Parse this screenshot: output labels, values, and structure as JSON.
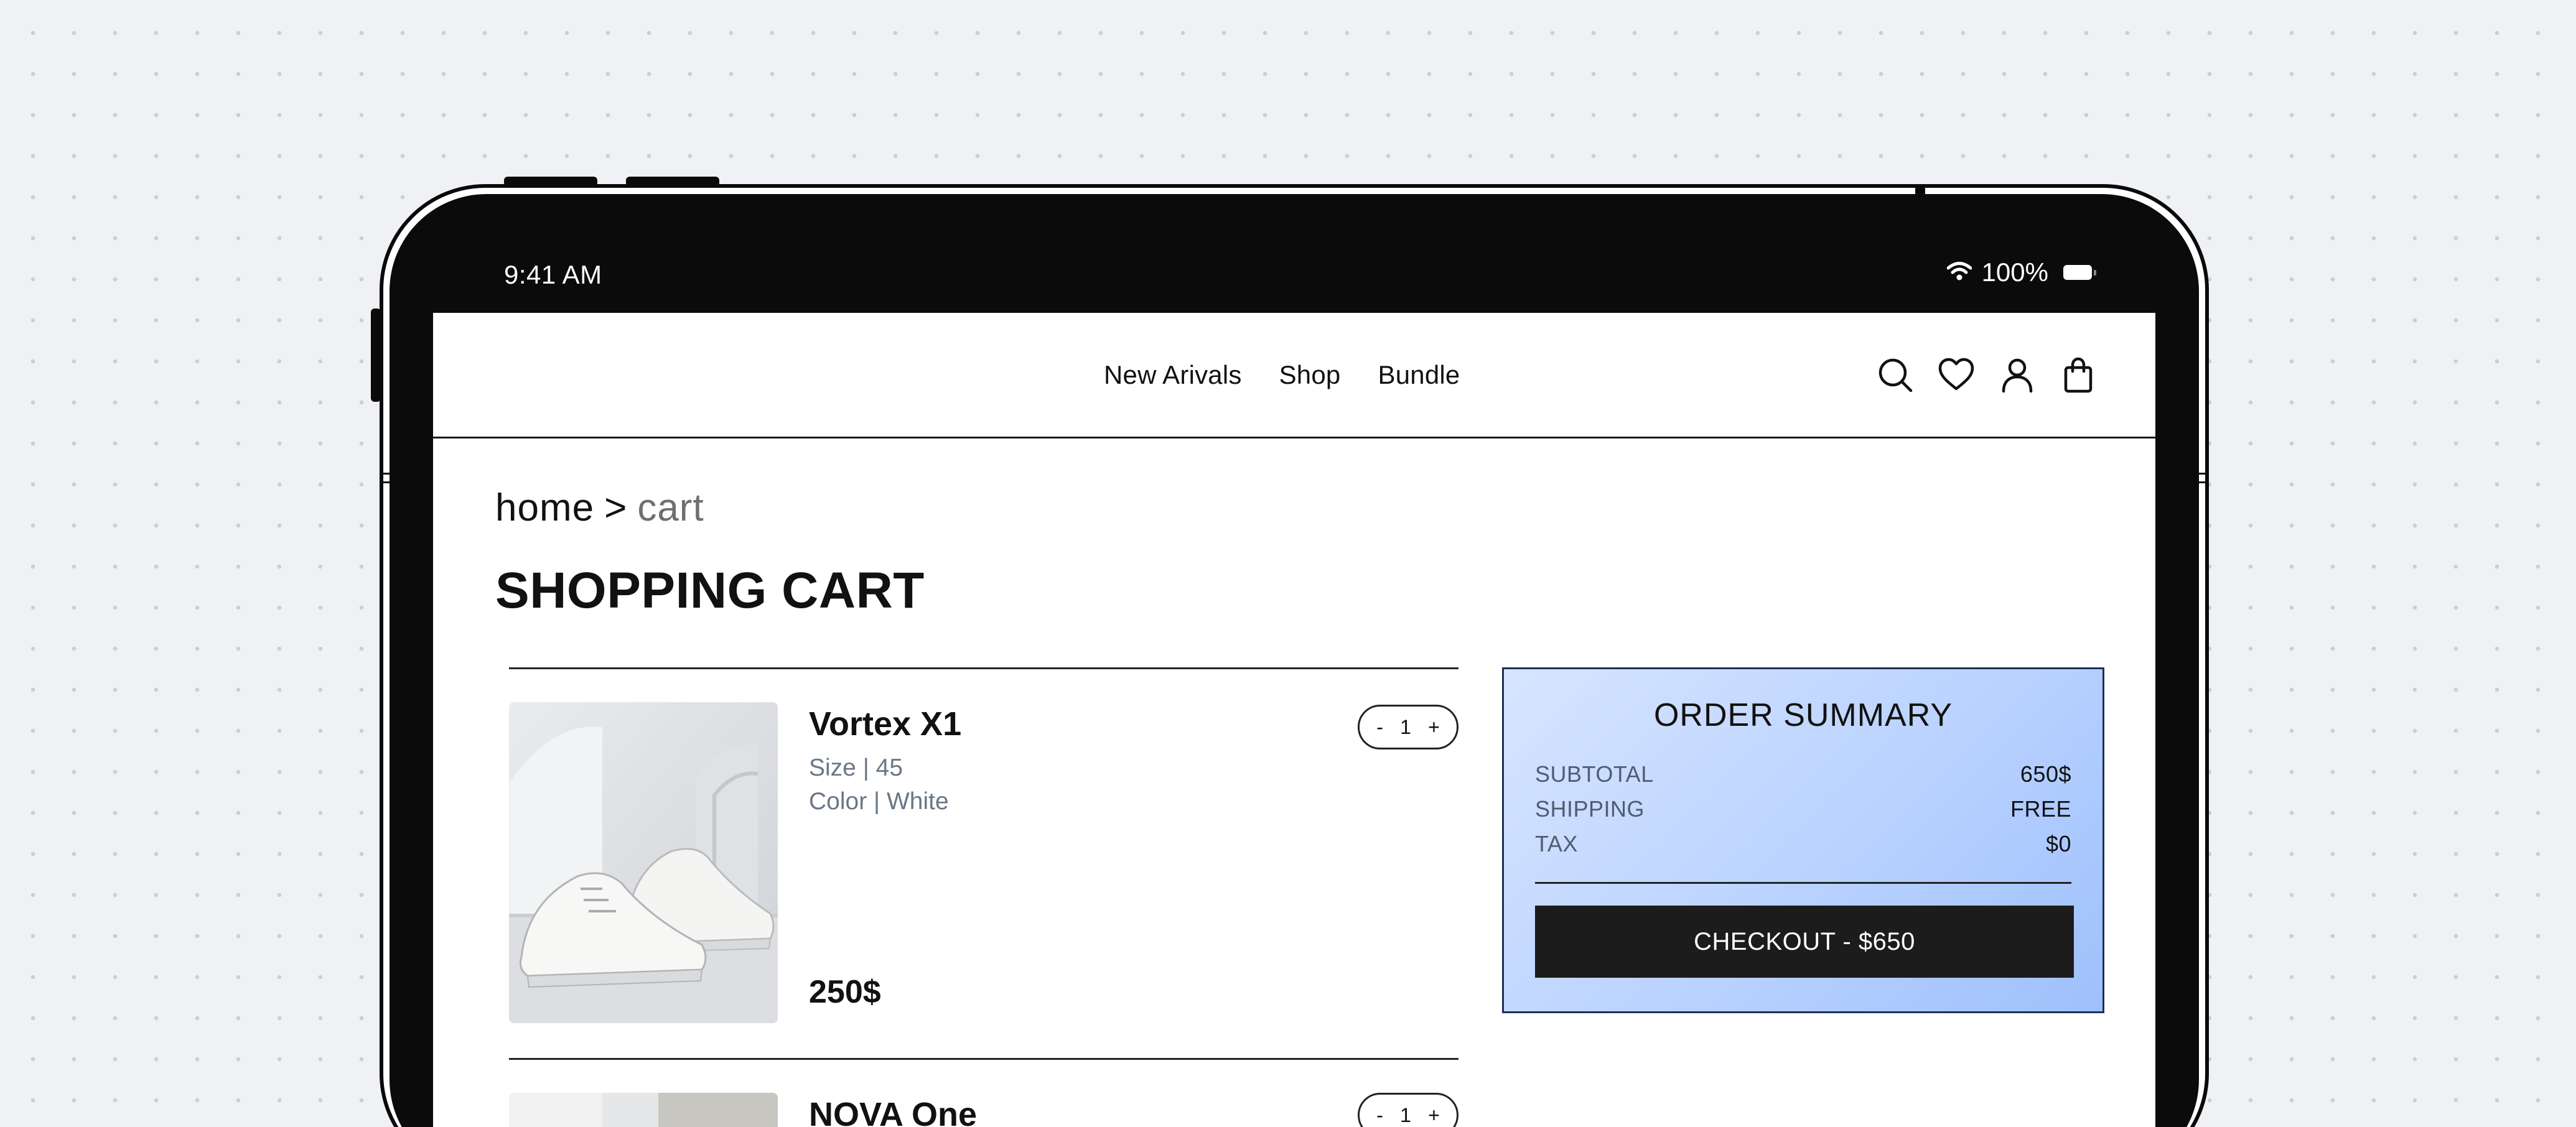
{
  "status_bar": {
    "time": "9:41 AM",
    "battery": "100%",
    "icons": [
      "wifi-icon",
      "battery-icon"
    ]
  },
  "nav": {
    "links": [
      "New Arivals",
      "Shop",
      "Bundle"
    ],
    "icons": [
      "search-icon",
      "heart-icon",
      "user-icon",
      "bag-icon"
    ]
  },
  "breadcrumb": {
    "home": "home",
    "separator": ">",
    "current": "cart"
  },
  "page_title": "SHOPPING CART",
  "cart_items": [
    {
      "name": "Vortex X1",
      "size": "Size | 45",
      "color": "Color | White",
      "price": "250$",
      "qty": {
        "minus": "-",
        "value": "1",
        "plus": "+"
      }
    },
    {
      "name": "NOVA One",
      "qty": {
        "minus": "-",
        "value": "1",
        "plus": "+"
      }
    }
  ],
  "summary": {
    "title": "ORDER SUMMARY",
    "rows": [
      {
        "label": "SUBTOTAL",
        "value": "650$"
      },
      {
        "label": "SHIPPING",
        "value": "FREE"
      },
      {
        "label": "TAX",
        "value": "$0"
      }
    ],
    "checkout_label": "CHECKOUT - $650"
  },
  "colors": {
    "background": "#eff1f5",
    "device": "#0b0b0b",
    "summary_gradient_start": "#d7e5ff",
    "summary_gradient_end": "#9ec0fc",
    "checkout_button": "#1c1c1c",
    "muted_text": "#6a7786"
  }
}
